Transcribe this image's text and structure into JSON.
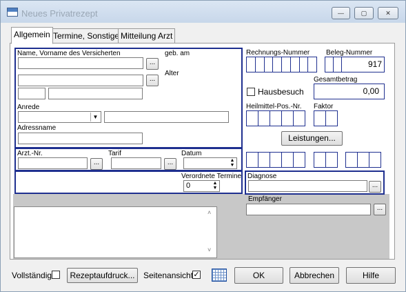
{
  "window": {
    "title": "Neues Privatrezept",
    "min_glyph": "—",
    "max_glyph": "▢",
    "close_glyph": "✕"
  },
  "tabs": [
    "Allgemein",
    "Termine, Sonstiges",
    "Mitteilung Arzt"
  ],
  "patient": {
    "name_label": "Name, Vorname des Versicherten",
    "birth_label": "geb. am",
    "age_label": "Alter",
    "salutation_label": "Anrede",
    "address_name_label": "Adressname",
    "dots": "..."
  },
  "doctor": {
    "arzt_label": "Arzt.-Nr.",
    "tarif_label": "Tarif",
    "datum_label": "Datum",
    "termine_label": "Verordnete Termine",
    "termine_value": "0"
  },
  "billing": {
    "rechnungs_label": "Rechnungs-Nummer",
    "beleg_label": "Beleg-Nummer",
    "beleg_value": "917",
    "gesamt_label": "Gesamtbetrag",
    "gesamt_value": "0,00",
    "hausbesuch_label": "Hausbesuch",
    "heilmittel_label": "Heilmittel-Pos.-Nr.",
    "faktor_label": "Faktor",
    "leistungen_label": "Leistungen..."
  },
  "diagnose": {
    "label": "Diagnose",
    "empfaenger_label": "Empfänger"
  },
  "footer": {
    "vollstaendig_label": "Vollständig",
    "rezept_label": "Rezeptaufdruck...",
    "seitenansicht_label": "Seitenansicht",
    "check_glyph": "✓",
    "ok_label": "OK",
    "abbrechen_label": "Abbrechen",
    "hilfe_label": "Hilfe"
  }
}
